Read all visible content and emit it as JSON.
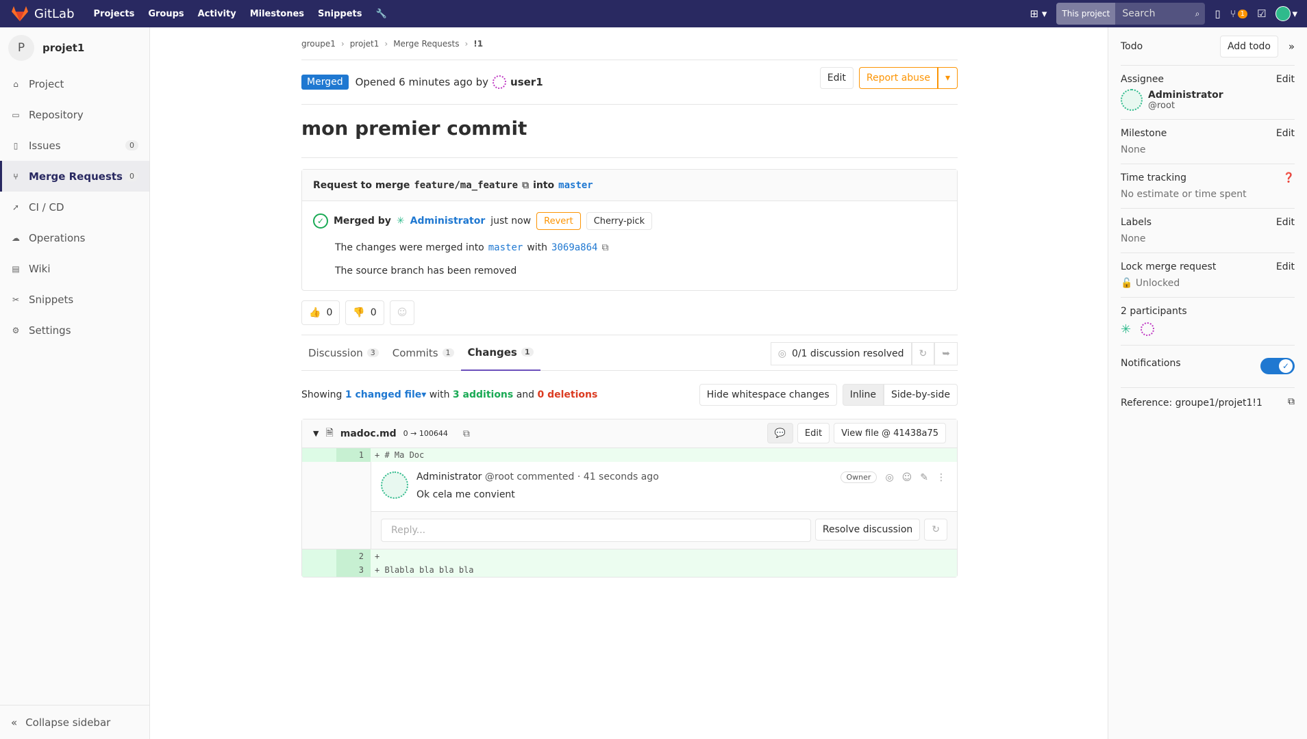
{
  "topbar": {
    "logo_text": "GitLab",
    "nav": [
      "Projects",
      "Groups",
      "Activity",
      "Milestones",
      "Snippets"
    ],
    "search_scope": "This project",
    "search_placeholder": "Search",
    "mr_count": "1"
  },
  "sidebar": {
    "project_initial": "P",
    "project_name": "projet1",
    "items": [
      {
        "label": "Project",
        "icon": "home-icon"
      },
      {
        "label": "Repository",
        "icon": "book-icon"
      },
      {
        "label": "Issues",
        "icon": "issues-icon",
        "count": "0"
      },
      {
        "label": "Merge Requests",
        "icon": "merge-request-icon",
        "count": "0",
        "active": true
      },
      {
        "label": "CI / CD",
        "icon": "rocket-icon"
      },
      {
        "label": "Operations",
        "icon": "cloud-icon"
      },
      {
        "label": "Wiki",
        "icon": "book-open-icon"
      },
      {
        "label": "Snippets",
        "icon": "scissors-icon"
      },
      {
        "label": "Settings",
        "icon": "gear-icon"
      }
    ],
    "collapse_label": "Collapse sidebar"
  },
  "breadcrumb": [
    "groupe1",
    "projet1",
    "Merge Requests",
    "!1"
  ],
  "mr": {
    "status": "Merged",
    "opened_text": "Opened 6 minutes ago by",
    "author": "user1",
    "edit_label": "Edit",
    "report_label": "Report abuse",
    "title": "mon premier commit",
    "request_prefix": "Request to merge",
    "source_branch": "feature/ma_feature",
    "into": "into",
    "target_branch": "master",
    "merged_by_label": "Merged by",
    "merged_by_user": "Administrator",
    "merged_when": "just now",
    "revert_label": "Revert",
    "cherry_label": "Cherry-pick",
    "merged_into_text": "The changes were merged into",
    "merged_into_branch": "master",
    "with": "with",
    "commit_sha": "3069a864",
    "source_removed": "The source branch has been removed",
    "thumbs_up": "0",
    "thumbs_down": "0"
  },
  "tabs": [
    {
      "label": "Discussion",
      "count": "3"
    },
    {
      "label": "Commits",
      "count": "1"
    },
    {
      "label": "Changes",
      "count": "1",
      "active": true
    }
  ],
  "resolved_text": "0/1 discussion resolved",
  "diffstats": {
    "showing": "Showing",
    "changed": "1 changed file",
    "with": "with",
    "additions": "3 additions",
    "and": "and",
    "deletions": "0 deletions",
    "hide_ws": "Hide whitespace changes",
    "inline": "Inline",
    "side": "Side-by-side"
  },
  "file": {
    "name": "madoc.md",
    "mode": "0 → 100644",
    "edit": "Edit",
    "view": "View file @ 41438a75",
    "lines": [
      {
        "num": "1",
        "code": "+ # Ma Doc"
      },
      {
        "num": "2",
        "code": "+"
      },
      {
        "num": "3",
        "code": "+ Blabla bla bla bla"
      }
    ]
  },
  "note": {
    "author": "Administrator",
    "handle": "@root commented",
    "time": "· 41 seconds ago",
    "role": "Owner",
    "body": "Ok cela me convient",
    "reply_placeholder": "Reply...",
    "resolve_label": "Resolve discussion"
  },
  "right": {
    "todo": "Todo",
    "add_todo": "Add todo",
    "assignee": "Assignee",
    "edit": "Edit",
    "assignee_name": "Administrator",
    "assignee_handle": "@root",
    "milestone": "Milestone",
    "none": "None",
    "time_tracking": "Time tracking",
    "time_value": "No estimate or time spent",
    "labels": "Labels",
    "lock": "Lock merge request",
    "unlocked": "Unlocked",
    "participants": "2 participants",
    "notifications": "Notifications",
    "reference": "Reference: groupe1/projet1!1"
  }
}
